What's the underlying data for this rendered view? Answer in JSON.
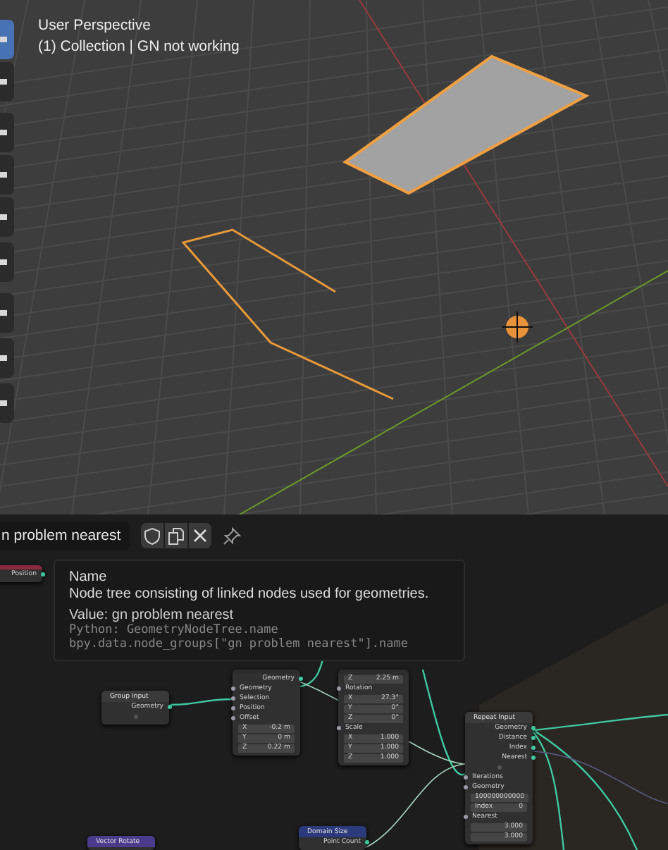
{
  "viewport": {
    "view_name": "User Perspective",
    "collection_line": "(1) Collection | GN not working",
    "tools": [
      {
        "selected": true
      },
      {
        "selected": false
      },
      {
        "selected": false
      },
      {
        "selected": false
      },
      {
        "selected": false
      },
      {
        "selected": false
      },
      {
        "selected": false
      },
      {
        "selected": false
      },
      {
        "selected": false
      }
    ]
  },
  "node_editor": {
    "tree_name": "n problem nearest",
    "nodes": [
      {
        "color": "#8c2a40",
        "rows": [
          {
            "kind": "output",
            "label": "Position"
          }
        ]
      },
      {
        "title": "Group Input",
        "color": "#3a3a3a",
        "rows": [
          {
            "kind": "output",
            "label": "Geometry"
          },
          {
            "kind": "spare"
          }
        ]
      },
      {
        "color": "#2d2d2d",
        "rows": [
          {
            "kind": "output",
            "label": "Geometry"
          },
          {
            "kind": "input",
            "label": "Geometry"
          },
          {
            "kind": "input",
            "label": "Selection"
          },
          {
            "kind": "input",
            "label": "Position"
          },
          {
            "kind": "input",
            "label": "Offset"
          },
          {
            "kind": "field",
            "label": "X",
            "value": "-0.2 m"
          },
          {
            "kind": "field",
            "label": "Y",
            "value": "0 m"
          },
          {
            "kind": "field",
            "label": "Z",
            "value": "0.22 m"
          }
        ]
      },
      {
        "color": "#2d2d2d",
        "rows": [
          {
            "kind": "field",
            "label": "Z",
            "value": "2.25 m"
          },
          {
            "kind": "input",
            "label": "Rotation"
          },
          {
            "kind": "field",
            "label": "X",
            "value": "27.3°"
          },
          {
            "kind": "field",
            "label": "Y",
            "value": "0°"
          },
          {
            "kind": "field",
            "label": "Z",
            "value": "0°"
          },
          {
            "kind": "input",
            "label": "Scale"
          },
          {
            "kind": "field",
            "label": "X",
            "value": "1.000"
          },
          {
            "kind": "field",
            "label": "Y",
            "value": "1.000"
          },
          {
            "kind": "field",
            "label": "Z",
            "value": "1.000"
          }
        ]
      },
      {
        "title": "Repeat Input",
        "color": "#3a3a3a",
        "rows": [
          {
            "kind": "output",
            "label": "Geometry"
          },
          {
            "kind": "output",
            "label": "Distance"
          },
          {
            "kind": "output",
            "label": "Index"
          },
          {
            "kind": "output",
            "label": "Nearest"
          },
          {
            "kind": "spare"
          },
          {
            "kind": "input",
            "label": "Iterations"
          },
          {
            "kind": "input",
            "label": "Geometry"
          },
          {
            "kind": "field",
            "value": "100000000000"
          },
          {
            "kind": "field",
            "label": "Index",
            "value": "0"
          },
          {
            "kind": "input",
            "label": "Nearest"
          },
          {
            "kind": "field",
            "value": "3.000"
          },
          {
            "kind": "field",
            "value": "3.000"
          }
        ]
      },
      {
        "title": "Vector Rotate",
        "color": "#4a3b8c"
      },
      {
        "title": "Domain Size",
        "color": "#2b3a7a",
        "rows": [
          {
            "kind": "output",
            "label": "Point Count"
          }
        ]
      }
    ]
  },
  "tooltip": {
    "title": "Name",
    "description": "Node tree consisting of linked nodes used for geometries.",
    "value": "Value: gn problem nearest",
    "python": [
      "Python: GeometryNodeTree.name",
      "bpy.data.node_groups[\"gn problem nearest\"].name"
    ]
  }
}
